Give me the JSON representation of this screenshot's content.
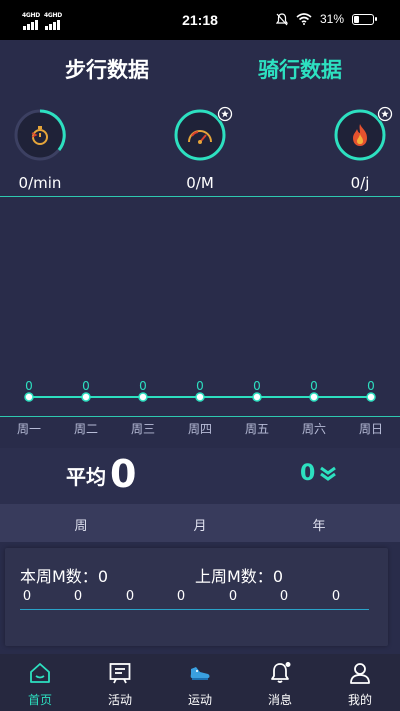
{
  "status_bar": {
    "network_1": "4GHD",
    "network_2": "4GHD",
    "time": "21:18",
    "battery": "31%",
    "battery_level": 0.31
  },
  "header": {
    "walk_tab": "步行数据",
    "ride_tab": "骑行数据"
  },
  "metrics": [
    {
      "value": "0/min",
      "icon": "stopwatch-icon"
    },
    {
      "value": "0/M",
      "icon": "speedometer-icon"
    },
    {
      "value": "0/j",
      "icon": "flame-icon"
    }
  ],
  "chart_data": {
    "type": "line",
    "categories": [
      "周一",
      "周二",
      "周三",
      "周四",
      "周五",
      "周六",
      "周日"
    ],
    "values": [
      0,
      0,
      0,
      0,
      0,
      0,
      0
    ],
    "data_labels": [
      "0",
      "0",
      "0",
      "0",
      "0",
      "0",
      "0"
    ],
    "xlabel": "",
    "ylabel": "",
    "title": "",
    "grid": false,
    "color": "#2de0c0"
  },
  "average": {
    "label": "平均",
    "value": "0",
    "right_value": "0"
  },
  "periods": [
    "周",
    "月",
    "年"
  ],
  "weekly_card": {
    "this_week_label": "本周M数：",
    "this_week_value": "0",
    "last_week_label": "上周M数：",
    "last_week_value": "0",
    "values": [
      "0",
      "0",
      "0",
      "0",
      "0",
      "0",
      "0"
    ]
  },
  "nav": [
    {
      "label": "首页",
      "icon": "home-icon"
    },
    {
      "label": "活动",
      "icon": "activity-board-icon"
    },
    {
      "label": "运动",
      "icon": "sneaker-icon"
    },
    {
      "label": "消息",
      "icon": "bell-icon"
    },
    {
      "label": "我的",
      "icon": "user-icon"
    }
  ],
  "colors": {
    "accent": "#2de0c0",
    "background": "#292c4a",
    "nav_background": "#26283f"
  }
}
